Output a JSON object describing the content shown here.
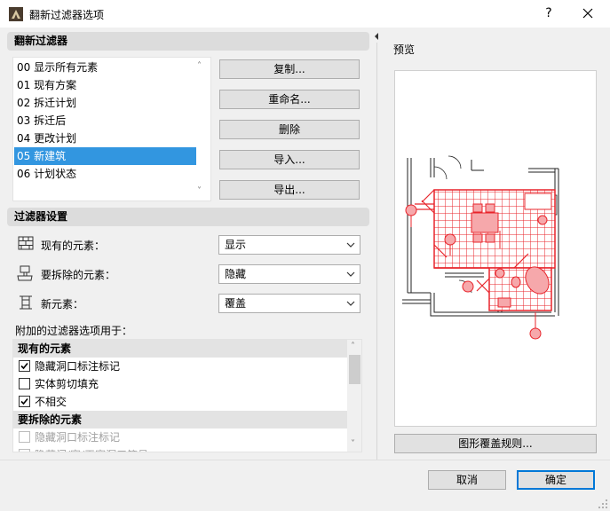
{
  "window": {
    "title": "翻新过滤器选项",
    "help_label": "?"
  },
  "filters_section": {
    "header": "翻新过滤器",
    "items": [
      {
        "label": "00 显示所有元素"
      },
      {
        "label": "01 现有方案"
      },
      {
        "label": "02 拆迁计划"
      },
      {
        "label": "03 拆迁后"
      },
      {
        "label": "04 更改计划"
      },
      {
        "label": "05 新建筑",
        "selected": true
      },
      {
        "label": "06 计划状态"
      }
    ],
    "buttons": {
      "copy": "复制...",
      "rename": "重命名...",
      "delete": "删除",
      "import": "导入...",
      "export": "导出..."
    }
  },
  "settings_section": {
    "header": "过滤器设置",
    "rows": [
      {
        "label": "现有的元素：",
        "value": "显示"
      },
      {
        "label": "要拆除的元素：",
        "value": "隐藏"
      },
      {
        "label": "新元素：",
        "value": "覆盖"
      }
    ]
  },
  "options": {
    "caption": "附加的过滤器选项用于：",
    "groups": [
      {
        "title": "现有的元素",
        "items": [
          {
            "label": "隐藏洞口标注标记",
            "checked": true
          },
          {
            "label": "实体剪切填充",
            "checked": false
          },
          {
            "label": "不相交",
            "checked": true
          }
        ]
      },
      {
        "title": "要拆除的元素",
        "items": [
          {
            "label": "隐藏洞口标注标记",
            "checked": false,
            "disabled": true
          },
          {
            "label": "隐藏门/窗/天窗洞口符号",
            "checked": false,
            "disabled": true
          }
        ]
      }
    ]
  },
  "preview": {
    "label": "预览",
    "override_button": "图形覆盖规则..."
  },
  "footer": {
    "cancel": "取消",
    "ok": "确定"
  },
  "colors": {
    "accent": "#3296e0",
    "plan_red": "#e8242b",
    "default_border": "#0078d7"
  }
}
